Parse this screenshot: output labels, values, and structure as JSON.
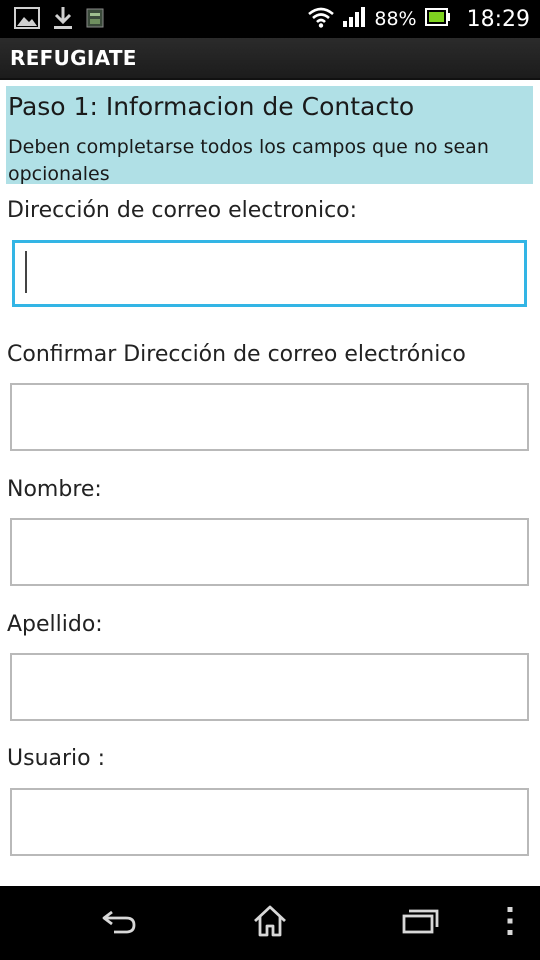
{
  "status_bar": {
    "icons_left": [
      "gallery-icon",
      "download-icon",
      "app-notification-icon"
    ],
    "icons_right": [
      "wifi-icon",
      "signal-icon",
      "battery-icon"
    ],
    "battery_percent": "88%",
    "time": "18:29"
  },
  "app": {
    "title": "REFUGIATE"
  },
  "form": {
    "step_title": "Paso 1: Informacion de Contacto",
    "step_subtitle": "Deben completarse todos los campos que no sean opcionales",
    "fields": [
      {
        "label": "Dirección de correo electronico:",
        "value": "",
        "focused": true
      },
      {
        "label": "Confirmar Dirección de correo electrónico",
        "value": "",
        "focused": false
      },
      {
        "label": "Nombre:",
        "value": "",
        "focused": false
      },
      {
        "label": "Apellido:",
        "value": "",
        "focused": false
      },
      {
        "label": "Usuario :",
        "value": "",
        "focused": false
      }
    ]
  },
  "nav_bar": {
    "buttons": [
      "back-icon",
      "home-icon",
      "recent-apps-icon",
      "menu-icon"
    ]
  },
  "colors": {
    "header_background": "#b0e0e6",
    "focus_border": "#33b5e5",
    "input_border": "#b9b9b9",
    "battery_green": "#7fd320"
  }
}
